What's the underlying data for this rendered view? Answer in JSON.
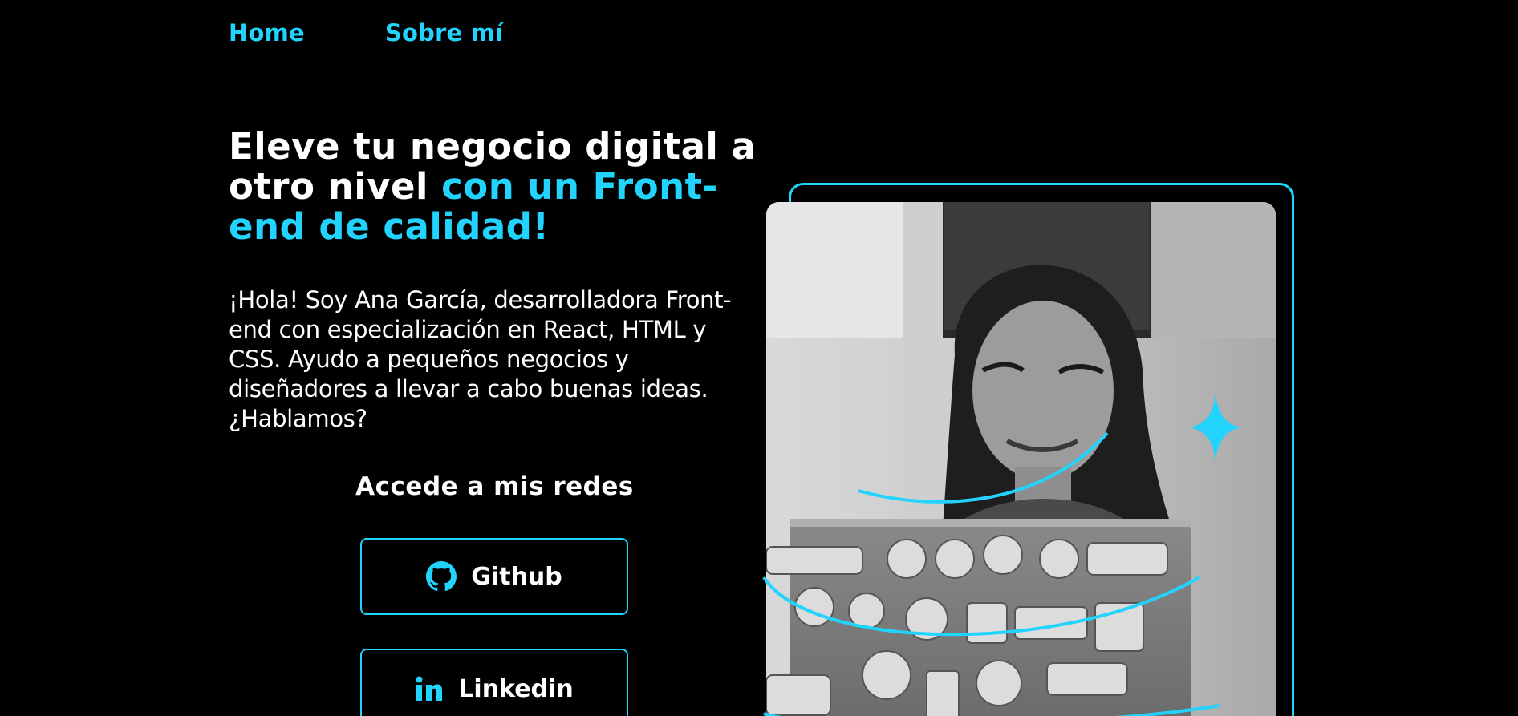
{
  "nav": {
    "items": [
      {
        "label": "Home"
      },
      {
        "label": "Sobre mí"
      }
    ]
  },
  "hero": {
    "headline_white": "Eleve tu negocio digital a otro nivel ",
    "headline_accent": "con un Front-end de calidad!",
    "intro": "¡Hola! Soy Ana García, desarrolladora Front-end con especialización en React, HTML y CSS. Ayudo a pequeños negocios y diseñadores a llevar a cabo buenas ideas. ¿Hablamos?"
  },
  "social": {
    "title": "Accede a mis redes",
    "buttons": [
      {
        "label": "Github",
        "icon": "github-icon"
      },
      {
        "label": "Linkedin",
        "icon": "linkedin-icon"
      }
    ]
  },
  "colors": {
    "accent": "#22d4fd",
    "background": "#000000",
    "text": "#ffffff"
  }
}
